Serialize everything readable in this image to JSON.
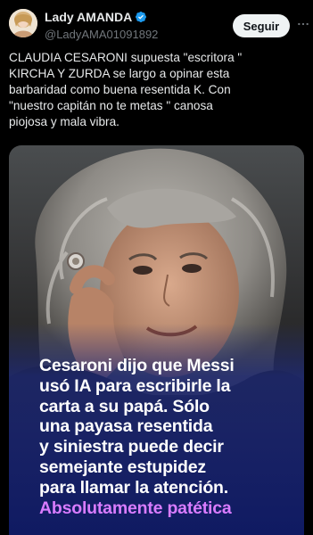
{
  "header": {
    "display_name": "Lady AMANDA",
    "handle": "@LadyAMA01091892",
    "follow_label": "Seguir",
    "verified_color": "#1d9bf0"
  },
  "tweet": {
    "lines": [
      "CLAUDIA CESARONI  supuesta \"escritora \"",
      "KIRCHA Y ZURDA se largo a opinar esta",
      "barbaridad como buena resentida K.  Con",
      "\"nuestro capitán no te metas \" canosa",
      "piojosa y mala vibra."
    ]
  },
  "media": {
    "caption_lines": [
      "Cesaroni dijo que Messi",
      "usó IA para escribirle la",
      "carta a su papá. Sólo",
      "una payasa resentida",
      "y siniestra puede decir",
      "semejante estupidez",
      "para llamar la atención."
    ],
    "caption_accent": "Absolutamente patética",
    "accent_color": "#d97cff",
    "overlay_color": "#1e2a7a"
  },
  "icons": {
    "verified": "verified-badge-icon",
    "more": "more-options-icon"
  }
}
